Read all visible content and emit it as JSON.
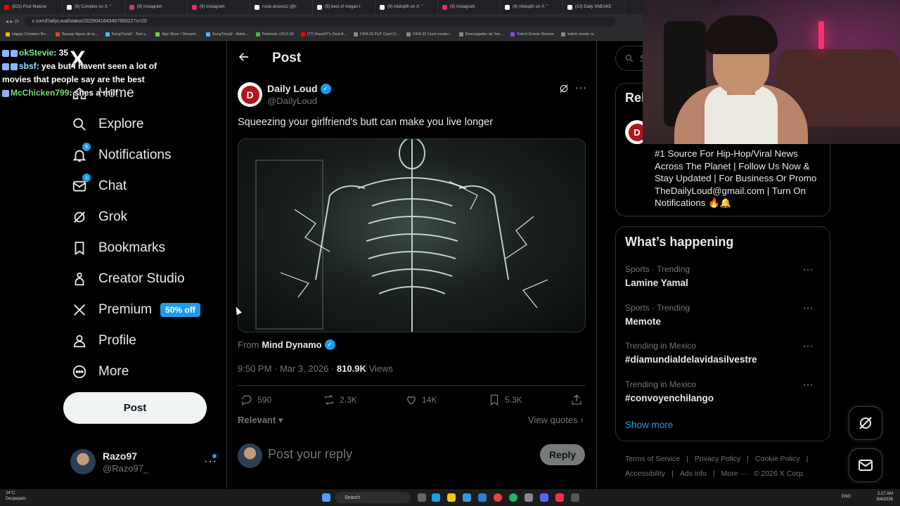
{
  "browser": {
    "tabs": [
      {
        "label": "(823) Post Malone",
        "color": "#ff0000"
      },
      {
        "label": "(9) Complex on X: \"",
        "color": "#ffffff"
      },
      {
        "label": "(9) Instagram",
        "color": "#e1306c"
      },
      {
        "label": "(9) Instagram",
        "color": "#e1306c"
      },
      {
        "label": "roxie.alvarezz (@r",
        "color": "#ffffff"
      },
      {
        "label": "(9) best of megan t",
        "color": "#ffffff"
      },
      {
        "label": "(9) midsqilh on X: \"",
        "color": "#ffffff"
      },
      {
        "label": "(9) Instagram",
        "color": "#e1306c"
      },
      {
        "label": "(9) midsqilh on X: \"",
        "color": "#ffffff"
      },
      {
        "label": "(10) Daily SNEAKE",
        "color": "#ffffff"
      }
    ],
    "url": "x.com/DailyLoud/status/2029041843467683227s=20",
    "bookmarks": [
      {
        "label": "Happy Cristiano Ro...",
        "color": "#ffb400"
      },
      {
        "label": "Buraqo figura de to...",
        "color": "#e34234"
      },
      {
        "label": "SongTrivia2 - Test y...",
        "color": "#4db6ff"
      },
      {
        "label": "App Store / Streami...",
        "color": "#7ec850"
      },
      {
        "label": "SongTrivia2 - Advin...",
        "color": "#4db6ff"
      },
      {
        "label": "Feletools v26.0.28",
        "color": "#4caf50"
      },
      {
        "label": "(77) Razo97's Zest-A...",
        "color": "#ff0000"
      },
      {
        "label": "FIFA 23 FUT Card Cr...",
        "color": "#888888"
      },
      {
        "label": "FIFA 23 Card creator...",
        "color": "#888888"
      },
      {
        "label": "Descargador de You...",
        "color": "#888888"
      },
      {
        "label": "Twitch Emote Resizer",
        "color": "#9146ff"
      },
      {
        "label": "twitch emote re...",
        "color": "#888888"
      }
    ]
  },
  "chat": [
    {
      "user": "okStevie",
      "msg": ": 35"
    },
    {
      "user": "sbsf",
      "msg": ": yea but i havent seen a lot of movies that people say are the best"
    },
    {
      "user": "McChicken799",
      "msg": ": shes a milf"
    }
  ],
  "sidebar": {
    "logo": "X",
    "items": [
      {
        "label": "Home",
        "icon": "home-icon"
      },
      {
        "label": "Explore",
        "icon": "search-icon"
      },
      {
        "label": "Notifications",
        "icon": "bell-icon",
        "badge": "9"
      },
      {
        "label": "Chat",
        "icon": "mail-icon",
        "badge": "1"
      },
      {
        "label": "Grok",
        "icon": "grok-icon"
      },
      {
        "label": "Bookmarks",
        "icon": "bookmark-icon"
      },
      {
        "label": "Creator Studio",
        "icon": "creator-icon"
      },
      {
        "label": "Premium",
        "icon": "x-icon",
        "promo": "50% off"
      },
      {
        "label": "Profile",
        "icon": "person-icon"
      },
      {
        "label": "More",
        "icon": "more-circle-icon"
      }
    ],
    "post_button": "Post",
    "account": {
      "name": "Razo97",
      "handle": "@Razo97_"
    }
  },
  "post": {
    "header": "Post",
    "author": {
      "name": "Daily Loud",
      "handle": "@DailyLoud",
      "avatar_letter": "D"
    },
    "text": "Squeezing your girlfriend's butt can make you live longer",
    "from_label": "From",
    "from_source": "Mind Dynamo",
    "time": "9:50 PM · Mar 3, 2026 · ",
    "views": "810.9K",
    "views_label": " Views",
    "stats": {
      "replies": "590",
      "reposts": "2.3K",
      "likes": "14K",
      "bookmarks": "5.3K"
    },
    "sort": "Relevant",
    "view_quotes": "View quotes",
    "reply_placeholder": "Post your reply",
    "reply_button": "Reply"
  },
  "right": {
    "search_placeholder": "Se",
    "relevant_title": "Rel",
    "bio": "#1 Source For Hip-Hop/Viral News Across The Planet | Follow Us Now & Stay Updated | For Business Or Promo TheDailyLoud@gmail.com | Turn On Notifications 🔥🔔",
    "whats_happening": "What’s happening",
    "trends": [
      {
        "context": "Sports · Trending",
        "topic": "Lamine Yamal"
      },
      {
        "context": "Sports · Trending",
        "topic": "Memote"
      },
      {
        "context": "Trending in Mexico",
        "topic": "#díamundialdelavidasilvestre"
      },
      {
        "context": "Trending in Mexico",
        "topic": "#convoyenchilango"
      }
    ],
    "show_more": "Show more",
    "footer_row1": [
      "Terms of Service",
      "|",
      "Privacy Policy",
      "|",
      "Cookie Policy",
      "|"
    ],
    "footer_row2": [
      "Accessibility",
      "|",
      "Ads info",
      "|",
      "More ···",
      "© 2026 X Corp."
    ]
  },
  "taskbar": {
    "weather_temp": "24°C",
    "weather_desc": "Despejado",
    "search": "Search",
    "lang": "ENG",
    "time": "2:27 AM",
    "date": "9/4/2026"
  },
  "colors": {
    "accent": "#1d9bf0",
    "background": "#000000",
    "border": "#2f3336",
    "muted": "#71767b"
  }
}
